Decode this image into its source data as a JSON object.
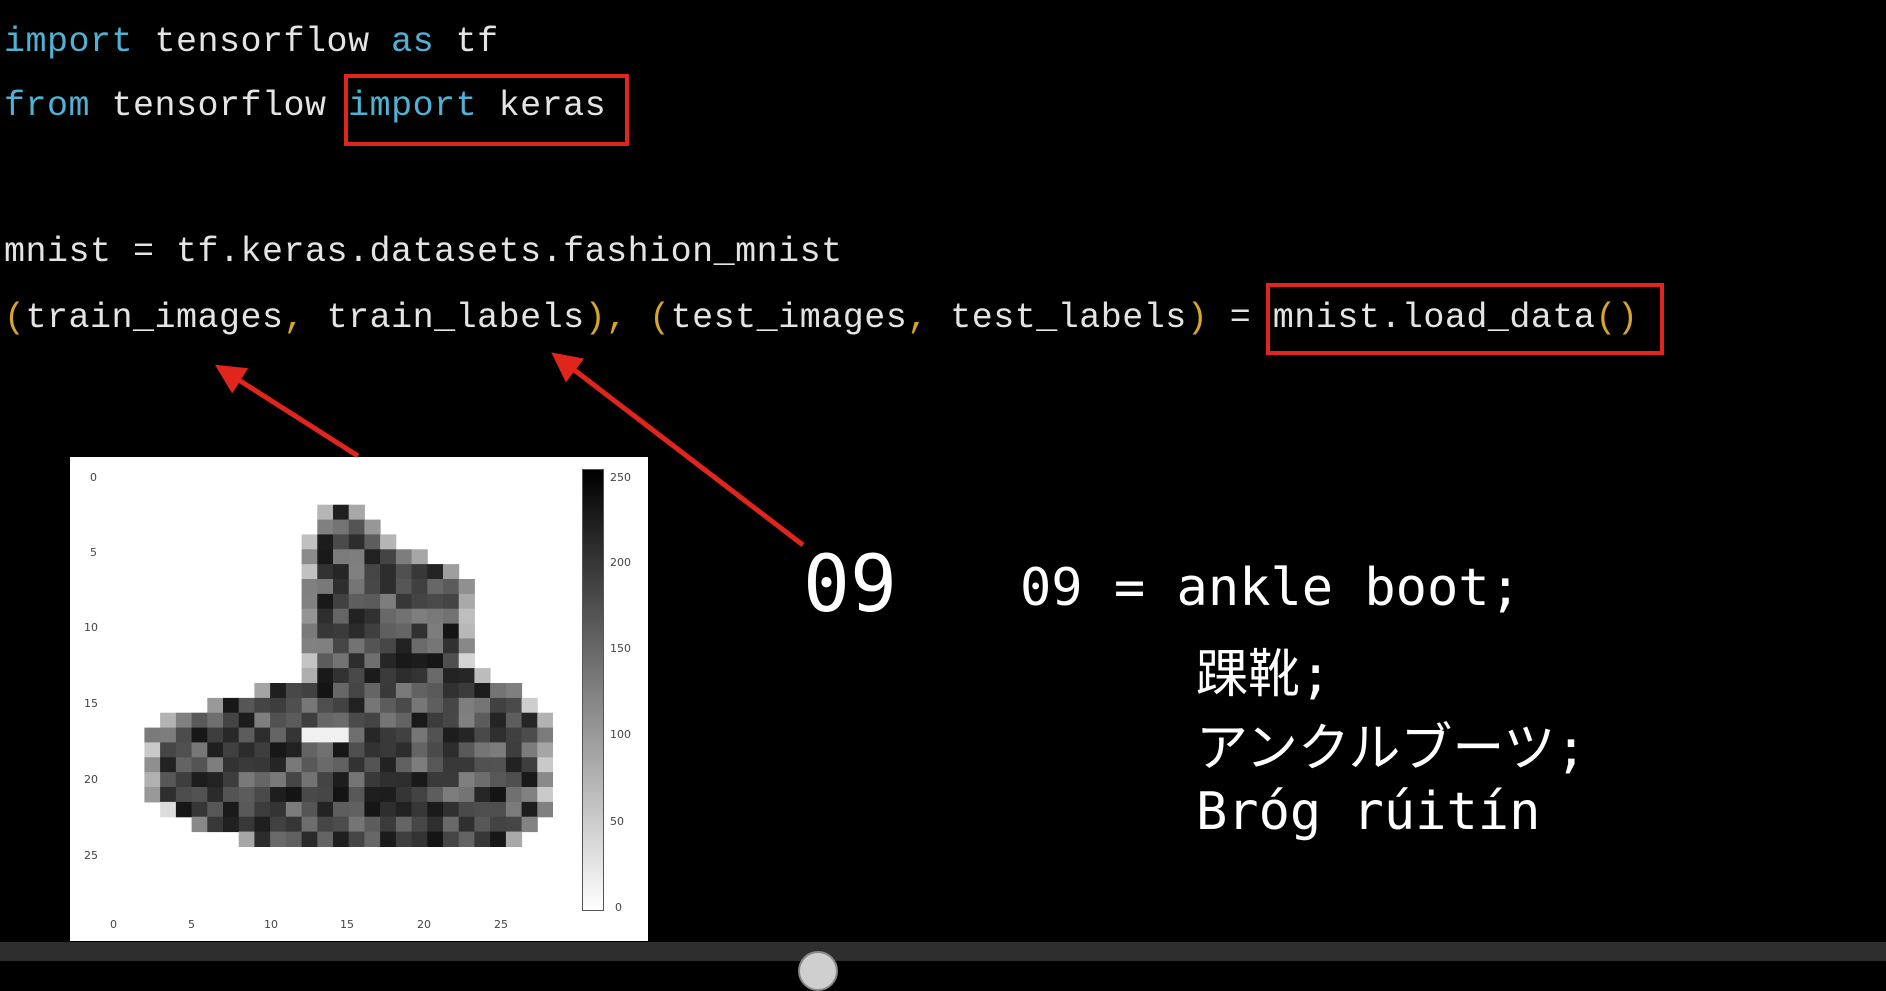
{
  "code": {
    "line1": {
      "kw1": "import",
      "t1": " tensorflow ",
      "kw2": "as",
      "t2": " tf"
    },
    "line2": {
      "kw1": "from",
      "t1": " tensorflow ",
      "kw2": "import",
      "t2": " keras"
    },
    "line3": {
      "text": "mnist = tf.keras.datasets.fashion_mnist"
    },
    "line4": {
      "p1": "(",
      "t1": "train_images",
      "c1": ",",
      "t2": " train_labels",
      "p2": ")",
      "c2": ",",
      "p3": " (",
      "t3": "test_images",
      "c3": ",",
      "t4": " test_labels",
      "p4": ")",
      "t5": " = mnist.load_data",
      "p5": "()"
    }
  },
  "figure": {
    "y_ticks": [
      "0",
      "5",
      "10",
      "15",
      "20",
      "25"
    ],
    "x_ticks": [
      "0",
      "5",
      "10",
      "15",
      "20",
      "25"
    ],
    "colorbar_ticks": [
      "250",
      "200",
      "150",
      "100",
      "50",
      "0"
    ]
  },
  "label_value": "09",
  "legend": {
    "line1": "09 = ankle boot;",
    "line2": "踝靴;",
    "line3": "アンクルブーツ;",
    "line4": "Bróg rúitín"
  },
  "colors": {
    "keyword": "#4fb1d4",
    "paren": "#d6a62a",
    "highlight_box": "#e0261c",
    "arrow": "#e0261c"
  }
}
